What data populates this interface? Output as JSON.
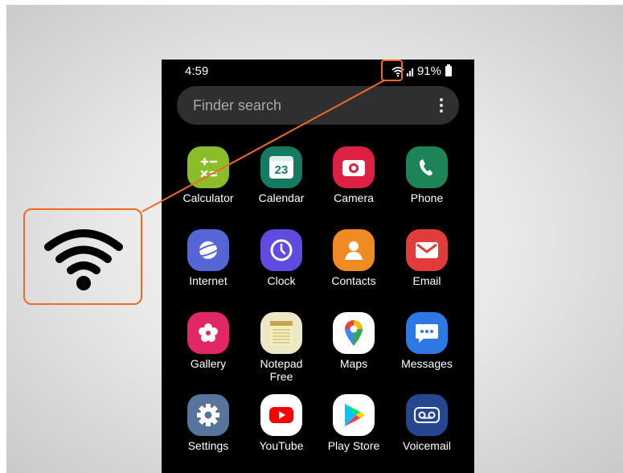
{
  "status": {
    "time": "4:59",
    "battery": "91%"
  },
  "search": {
    "placeholder": "Finder search"
  },
  "apps": [
    {
      "label": "Calculator",
      "icon": "calculator-icon",
      "color": "#8bbd2b"
    },
    {
      "label": "Calendar",
      "icon": "calendar-icon",
      "color": "#167a63",
      "day": "23"
    },
    {
      "label": "Camera",
      "icon": "camera-icon",
      "color": "#dc2144"
    },
    {
      "label": "Phone",
      "icon": "phone-icon",
      "color": "#1e8457"
    },
    {
      "label": "Internet",
      "icon": "internet-icon",
      "color": "#5565d6"
    },
    {
      "label": "Clock",
      "icon": "clock-icon",
      "color": "#5f4bdf"
    },
    {
      "label": "Contacts",
      "icon": "contacts-icon",
      "color": "#f08a23"
    },
    {
      "label": "Email",
      "icon": "email-icon",
      "color": "#e23b3b"
    },
    {
      "label": "Gallery",
      "icon": "gallery-icon",
      "color": "#e12864"
    },
    {
      "label": "Notepad\nFree",
      "icon": "notepad-icon",
      "color": "#ece7c7"
    },
    {
      "label": "Maps",
      "icon": "maps-icon",
      "color": "#ffffff"
    },
    {
      "label": "Messages",
      "icon": "messages-icon",
      "color": "#2c79e6"
    },
    {
      "label": "Settings",
      "icon": "settings-icon",
      "color": "#58749c"
    },
    {
      "label": "YouTube",
      "icon": "youtube-icon",
      "color": "#ffffff"
    },
    {
      "label": "Play Store",
      "icon": "play-store-icon",
      "color": "#ffffff"
    },
    {
      "label": "Voicemail",
      "icon": "voicemail-icon",
      "color": "#26468f"
    }
  ],
  "callout": {
    "icon": "wifi-icon",
    "color": "#ef6b25"
  }
}
